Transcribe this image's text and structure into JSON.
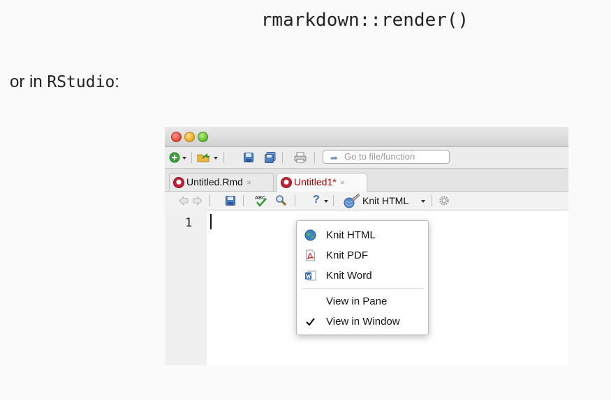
{
  "page": {
    "code_line": "rmarkdown::render()",
    "intro_prefix": "or in ",
    "intro_app": "RStudio",
    "intro_suffix": ":"
  },
  "toolbar": {
    "goto_placeholder": "Go to file/function"
  },
  "tabs": [
    {
      "label": "Untitled.Rmd",
      "close": "×",
      "active": false
    },
    {
      "label": "Untitled1*",
      "close": "×",
      "active": true
    }
  ],
  "editor_toolbar": {
    "knit_label": "Knit HTML",
    "spellcheck_badge": "ABC",
    "help_glyph": "?"
  },
  "editor": {
    "line_number": "1"
  },
  "knit_menu": {
    "items": [
      {
        "label": "Knit HTML",
        "icon": "globe-icon",
        "checked": false
      },
      {
        "label": "Knit PDF",
        "icon": "pdf-icon",
        "checked": false
      },
      {
        "label": "Knit Word",
        "icon": "word-icon",
        "checked": false
      },
      {
        "label": "View in Pane",
        "icon": "",
        "checked": false
      },
      {
        "label": "View in Window",
        "icon": "checkmark-icon",
        "checked": true
      }
    ]
  },
  "colors": {
    "active_tab_text": "#b00000",
    "link_blue": "#2f6fb5"
  }
}
